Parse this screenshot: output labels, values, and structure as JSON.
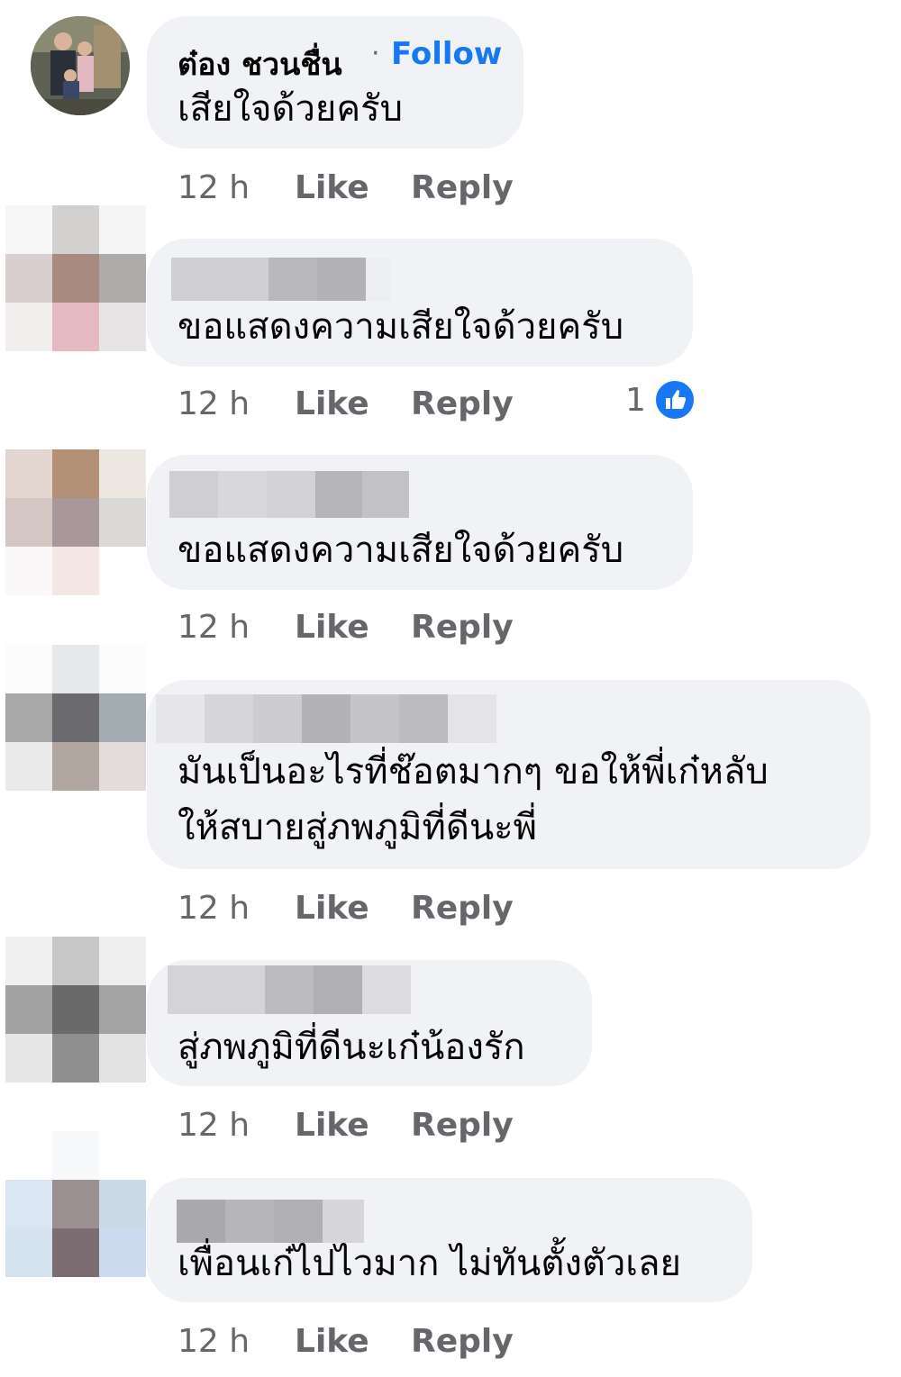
{
  "comments": [
    {
      "author": "ต๋อง ชวนชื่น",
      "follow_separator": "·",
      "follow_label": "Follow",
      "text": "เสียใจด้วยครับ",
      "time": "12 h",
      "like_label": "Like",
      "reply_label": "Reply"
    },
    {
      "text": "ขอแสดงความเสียใจด้วยครับ",
      "time": "12 h",
      "like_label": "Like",
      "reply_label": "Reply",
      "reaction_count": "1",
      "reaction_icon": "thumbs-up-icon"
    },
    {
      "text": "ขอแสดงความเสียใจด้วยครับ",
      "time": "12 h",
      "like_label": "Like",
      "reply_label": "Reply"
    },
    {
      "text_line1": "มันเป็นอะไรที่ช๊อตมากๆ  ขอให้พี่เก๋หลับ",
      "text_line2": "ให้สบายสู่ภพภูมิที่ดีนะพี่",
      "time": "12 h",
      "like_label": "Like",
      "reply_label": "Reply"
    },
    {
      "text": "สู่ภพภูมิที่ดีนะเก๋น้องรัก",
      "time": "12 h",
      "like_label": "Like",
      "reply_label": "Reply"
    },
    {
      "text": "เพื่อนเก๋ไปไวมาก ไม่ทันตั้งตัวเลย",
      "time": "12 h",
      "like_label": "Like",
      "reply_label": "Reply"
    }
  ],
  "colors": {
    "bubble": "#f0f2f5",
    "link": "#1877f2",
    "meta": "#65676b",
    "text": "#050505"
  }
}
